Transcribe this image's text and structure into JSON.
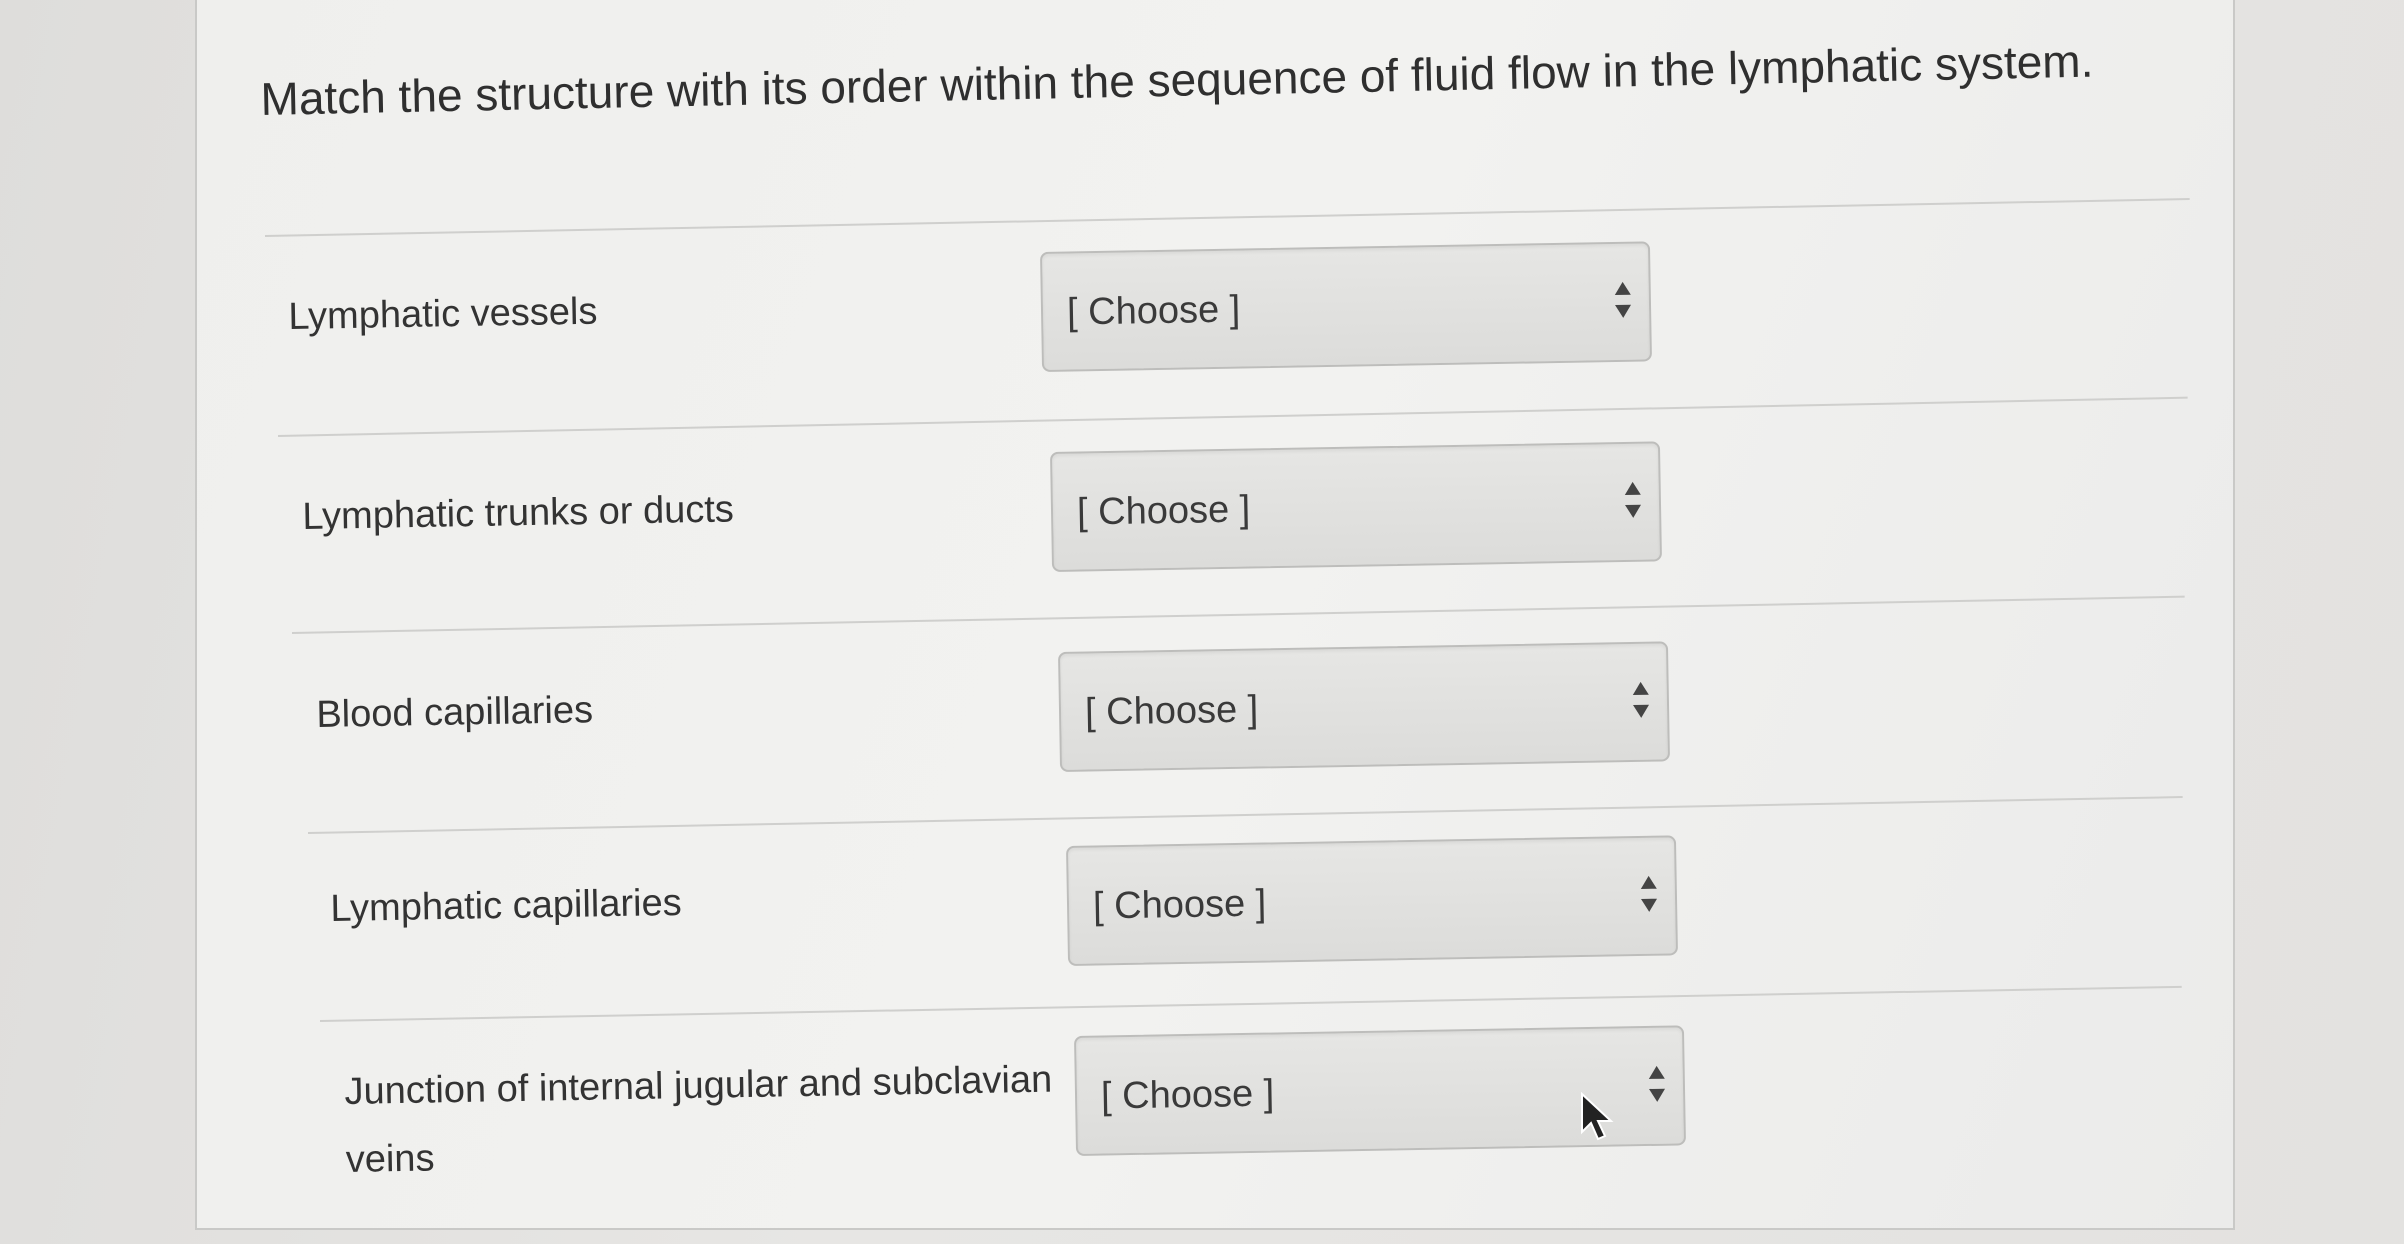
{
  "question": {
    "text": "Match the structure with its order within the sequence of fluid flow in the lymphatic system."
  },
  "rows": [
    {
      "label": "Lymphatic vessels",
      "selected": "[ Choose ]"
    },
    {
      "label": "Lymphatic trunks or ducts",
      "selected": "[ Choose ]"
    },
    {
      "label": "Blood capillaries",
      "selected": "[ Choose ]"
    },
    {
      "label": "Lymphatic capillaries",
      "selected": "[ Choose ]"
    },
    {
      "label": "Junction of internal jugular and subclavian veins",
      "selected": "[ Choose ]"
    }
  ],
  "icons": {
    "dropdown": "sort-arrows-icon",
    "pointer": "mouse-pointer-icon"
  }
}
